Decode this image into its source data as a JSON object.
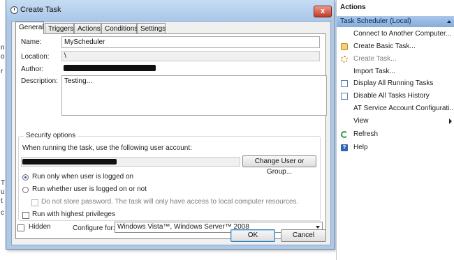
{
  "dialog": {
    "title": "Create Task",
    "close_glyph": "x",
    "tabs": [
      {
        "label": "General",
        "active": true
      },
      {
        "label": "Triggers",
        "active": false
      },
      {
        "label": "Actions",
        "active": false
      },
      {
        "label": "Conditions",
        "active": false
      },
      {
        "label": "Settings",
        "active": false
      }
    ],
    "general": {
      "name_label": "Name:",
      "name_value": "MyScheduler",
      "location_label": "Location:",
      "location_value": "\\",
      "author_label": "Author:",
      "description_label": "Description:",
      "description_value": "Testing..."
    },
    "security": {
      "title": "Security options",
      "prompt": "When running the task, use the following user account:",
      "change_button": "Change User or Group...",
      "radio_logged_on": "Run only when user is logged on",
      "radio_logged_on_or_not": "Run whether user is logged on or not",
      "selected_radio": "Run only when user is logged on",
      "no_store_password": "Do not store password.  The task will only have access to local computer resources.",
      "highest_privileges": "Run with highest privileges"
    },
    "hidden_label": "Hidden",
    "configure_label": "Configure for:",
    "configure_value": "Windows Vista™, Windows Server™ 2008",
    "ok_label": "OK",
    "cancel_label": "Cancel"
  },
  "actions_pane": {
    "header": "Actions",
    "section": "Task Scheduler (Local)",
    "items": [
      {
        "label": "Connect to Another Computer...",
        "icon": "none",
        "enabled": true
      },
      {
        "label": "Create Basic Task...",
        "icon": "wizard-icon",
        "enabled": true
      },
      {
        "label": "Create Task...",
        "icon": "gear-icon",
        "enabled": false
      },
      {
        "label": "Import Task...",
        "icon": "none",
        "enabled": true
      },
      {
        "label": "Display All Running Tasks",
        "icon": "list-icon",
        "enabled": true
      },
      {
        "label": "Disable All Tasks History",
        "icon": "history-icon",
        "enabled": true
      },
      {
        "label": "AT Service Account Configurati...",
        "icon": "none",
        "enabled": true
      },
      {
        "label": "View",
        "icon": "none",
        "enabled": true,
        "submenu": true
      },
      {
        "label": "Refresh",
        "icon": "refresh-icon",
        "enabled": true
      },
      {
        "label": "Help",
        "icon": "help-icon",
        "enabled": true
      }
    ]
  },
  "background_fragments": [
    "n",
    "o",
    "r",
    "T",
    "u",
    "t",
    "c"
  ]
}
